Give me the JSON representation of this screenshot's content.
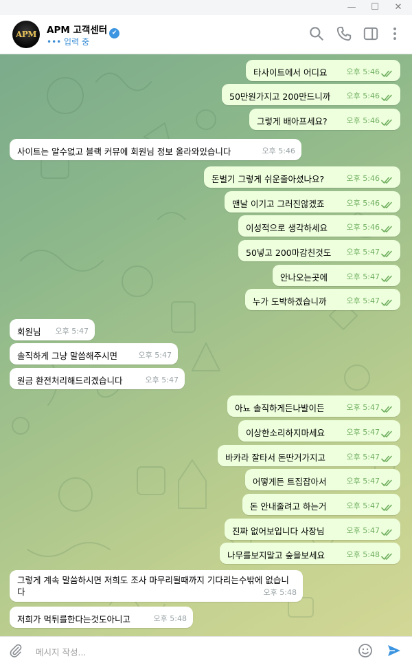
{
  "window": {
    "minimize": "—",
    "maximize": "☐",
    "close": "✕"
  },
  "header": {
    "avatar_text": "APM",
    "title": "APM 고객센터",
    "status": "••• 입력 중",
    "icons": [
      "search-icon",
      "phone-icon",
      "sidebar-toggle-icon",
      "more-icon"
    ]
  },
  "colors": {
    "accent": "#3c95e0",
    "outgoing_bubble": "#eeffde",
    "incoming_bubble": "#ffffff",
    "read_ticks": "#6fae5e"
  },
  "messages": [
    {
      "dir": "out",
      "text": "타사이트에서 어디요",
      "time": "오후 5:46"
    },
    {
      "dir": "out",
      "text": "50만원가지고 200만드니까",
      "time": "오후 5:46"
    },
    {
      "dir": "out",
      "text": "그렇게 배아프세요?",
      "time": "오후 5:46"
    },
    {
      "dir": "in",
      "text": "사이트는 알수없고 블랙 커뮤에 회원님 정보 올라와있습니다",
      "time": "오후 5:46"
    },
    {
      "dir": "out",
      "text": "돈벌기 그렇게 쉬운줄아셨나요?",
      "time": "오후 5:46"
    },
    {
      "dir": "out",
      "text": "맨날 이기고 그러진않겠죠",
      "time": "오후 5:46"
    },
    {
      "dir": "out",
      "text": "이성적으로 생각하세요",
      "time": "오후 5:46"
    },
    {
      "dir": "out",
      "text": "50넣고 200마감친것도",
      "time": "오후 5:47"
    },
    {
      "dir": "out",
      "text": "안나오는곳에",
      "time": "오후 5:47"
    },
    {
      "dir": "out",
      "text": "누가 도박하겠습니까",
      "time": "오후 5:47"
    },
    {
      "dir": "in",
      "text": "회원님",
      "time": "오후 5:47"
    },
    {
      "dir": "in",
      "text": "솔직하게 그냥 말씀해주시면",
      "time": "오후 5:47"
    },
    {
      "dir": "in",
      "text": "원금 환전처리해드리겠습니다",
      "time": "오후 5:47"
    },
    {
      "dir": "out",
      "text": "아뇨 솔직하게든나발이든",
      "time": "오후 5:47"
    },
    {
      "dir": "out",
      "text": "이상한소리하지마세요",
      "time": "오후 5:47"
    },
    {
      "dir": "out",
      "text": "바카라 잘타서 돈딴거가지고",
      "time": "오후 5:47"
    },
    {
      "dir": "out",
      "text": "어떻게든 트집잡아서",
      "time": "오후 5:47"
    },
    {
      "dir": "out",
      "text": "돈 안내줄려고 하는거",
      "time": "오후 5:47"
    },
    {
      "dir": "out",
      "text": "진짜 없어보입니다 사장님",
      "time": "오후 5:47"
    },
    {
      "dir": "out",
      "text": "나무를보지말고 숲을보세요",
      "time": "오후 5:48"
    },
    {
      "dir": "in",
      "text": "그렇게 계속 말씀하시면 저희도 조사 마무리될때까지 기다리는수밖에 없습니다",
      "time": "오후 5:48"
    },
    {
      "dir": "in",
      "text": "저희가 먹튀를한다는것도아니고",
      "time": "오후 5:48"
    }
  ],
  "composer": {
    "placeholder": "메시지 작성...",
    "icons": [
      "attach-icon",
      "emoji-icon",
      "send-icon"
    ]
  }
}
